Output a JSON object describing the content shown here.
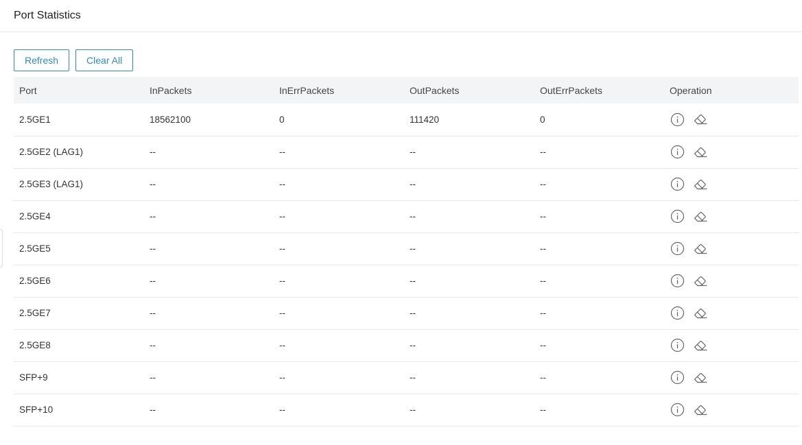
{
  "header": {
    "title": "Port Statistics"
  },
  "toolbar": {
    "refresh_label": "Refresh",
    "clear_all_label": "Clear All"
  },
  "table": {
    "columns": [
      "Port",
      "InPackets",
      "InErrPackets",
      "OutPackets",
      "OutErrPackets",
      "Operation"
    ],
    "rows": [
      {
        "port": "2.5GE1",
        "in_packets": "18562100",
        "in_err_packets": "0",
        "out_packets": "111420",
        "out_err_packets": "0"
      },
      {
        "port": "2.5GE2 (LAG1)",
        "in_packets": "--",
        "in_err_packets": "--",
        "out_packets": "--",
        "out_err_packets": "--"
      },
      {
        "port": "2.5GE3 (LAG1)",
        "in_packets": "--",
        "in_err_packets": "--",
        "out_packets": "--",
        "out_err_packets": "--"
      },
      {
        "port": "2.5GE4",
        "in_packets": "--",
        "in_err_packets": "--",
        "out_packets": "--",
        "out_err_packets": "--"
      },
      {
        "port": "2.5GE5",
        "in_packets": "--",
        "in_err_packets": "--",
        "out_packets": "--",
        "out_err_packets": "--"
      },
      {
        "port": "2.5GE6",
        "in_packets": "--",
        "in_err_packets": "--",
        "out_packets": "--",
        "out_err_packets": "--"
      },
      {
        "port": "2.5GE7",
        "in_packets": "--",
        "in_err_packets": "--",
        "out_packets": "--",
        "out_err_packets": "--"
      },
      {
        "port": "2.5GE8",
        "in_packets": "--",
        "in_err_packets": "--",
        "out_packets": "--",
        "out_err_packets": "--"
      },
      {
        "port": "SFP+9",
        "in_packets": "--",
        "in_err_packets": "--",
        "out_packets": "--",
        "out_err_packets": "--"
      },
      {
        "port": "SFP+10",
        "in_packets": "--",
        "in_err_packets": "--",
        "out_packets": "--",
        "out_err_packets": "--"
      }
    ],
    "operation_icons": [
      "info-icon",
      "eraser-icon"
    ]
  },
  "colors": {
    "accent": "#2f8ac4",
    "header_bg": "#f3f4f5",
    "divider": "#e8e8e8",
    "icon": "#666666"
  }
}
